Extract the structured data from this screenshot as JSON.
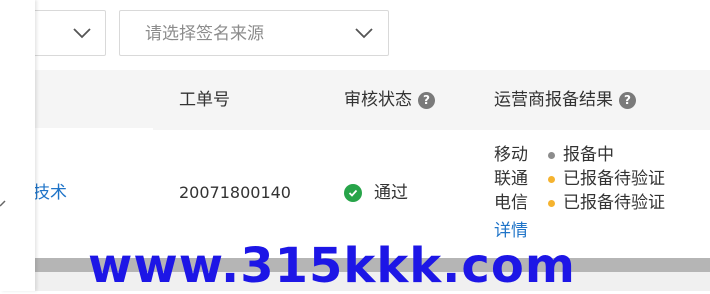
{
  "filters": {
    "source_select": {
      "placeholder": "请选择签名来源",
      "icon": "chevron-down-icon"
    },
    "first_select": {
      "icon": "chevron-down-icon"
    }
  },
  "table": {
    "headers": {
      "order_no": "工单号",
      "audit_status": "审核状态",
      "carrier_result": "运营商报备结果"
    },
    "row": {
      "name_partial": "技术",
      "order_no": "20071800140",
      "audit_status": "通过",
      "carriers": [
        {
          "name": "移动",
          "status": "报备中",
          "dot_color": "#8c8c8c"
        },
        {
          "name": "联通",
          "status": "已报备待验证",
          "dot_color": "#f5b32f"
        },
        {
          "name": "电信",
          "status": "已报备待验证",
          "dot_color": "#f5b32f"
        }
      ],
      "detail_link": "详情"
    }
  },
  "watermark": "www.315kkk.com",
  "colors": {
    "link": "#1f74c8",
    "success": "#27a449",
    "header_bg": "#f5f5f5",
    "watermark": "#1d16e6"
  }
}
